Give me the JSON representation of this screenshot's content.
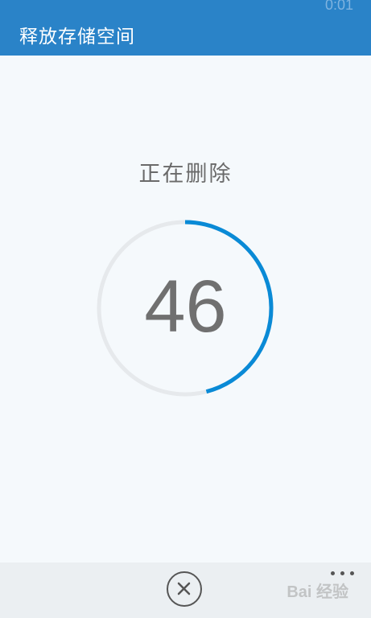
{
  "status_bar": {
    "time": "0:01"
  },
  "header": {
    "title": "释放存储空间"
  },
  "main": {
    "status_text": "正在删除",
    "progress": {
      "value": "46",
      "percent": 46
    }
  },
  "colors": {
    "accent": "#0a8ad6",
    "header_bg": "#2a83c8",
    "ring_track": "#e6e9ec"
  },
  "bottom_bar": {
    "cancel_icon": "close-icon",
    "more_icon": "more-dots-icon",
    "watermark": "Bai 经验"
  }
}
